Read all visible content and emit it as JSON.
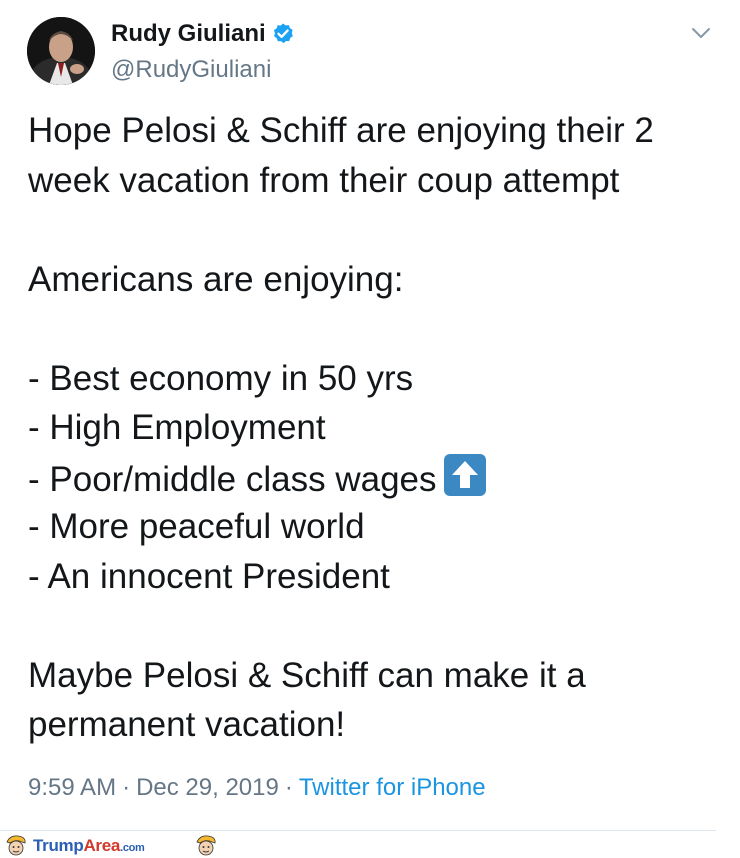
{
  "tweet": {
    "display_name": "Rudy Giuliani",
    "handle": "@RudyGiuliani",
    "body_lines": [
      "Hope Pelosi & Schiff are enjoying their 2",
      "week vacation from their coup attempt",
      "",
      "Americans are enjoying:",
      "",
      "- Best economy in 50 yrs",
      "- High Employment",
      "- Poor/middle class wages",
      "- More peaceful world",
      "- An innocent President",
      "",
      "Maybe Pelosi & Schiff can make it a",
      "permanent vacation!"
    ],
    "time": "9:59 AM",
    "date": "Dec 29, 2019",
    "separator": "·",
    "source": "Twitter for iPhone"
  },
  "icons": {
    "verified": "verified-badge-icon",
    "menu": "chevron-down-icon",
    "emoji": "up-arrow-emoji-icon"
  },
  "colors": {
    "text": "#14171a",
    "secondary": "#657786",
    "link": "#1b95e0",
    "verified": "#1da1f2",
    "emoji_bg": "#3b88c3"
  },
  "watermark": {
    "part1": "Trump",
    "part2": "Area",
    "part3": ".com"
  }
}
